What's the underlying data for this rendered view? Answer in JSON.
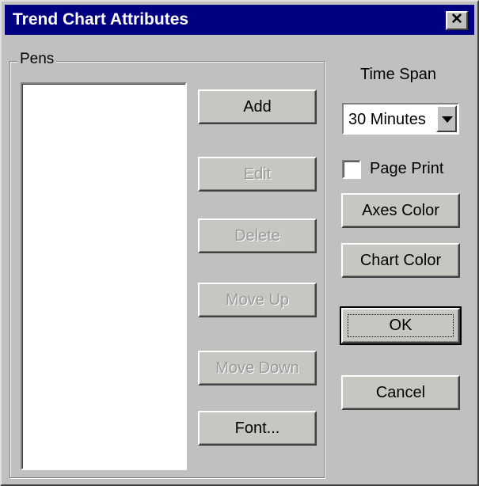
{
  "window": {
    "title": "Trend Chart Attributes",
    "close_glyph": "✕"
  },
  "pens": {
    "group_label": "Pens",
    "items": [],
    "buttons": {
      "add": "Add",
      "edit": "Edit",
      "delete": "Delete",
      "move_up": "Move Up",
      "move_down": "Move Down",
      "font": "Font..."
    }
  },
  "time_span": {
    "label": "Time Span",
    "selected": "30 Minutes"
  },
  "page_print": {
    "label": "Page Print",
    "checked": false
  },
  "buttons": {
    "axes_color": "Axes Color",
    "chart_color": "Chart Color",
    "ok": "OK",
    "cancel": "Cancel"
  }
}
